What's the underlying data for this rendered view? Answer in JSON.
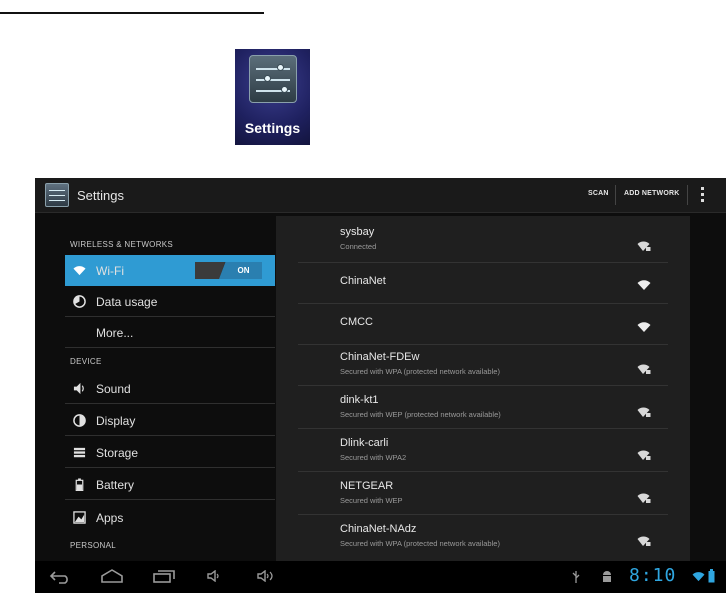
{
  "launcher_icon": {
    "label": "Settings",
    "icon": "settings-sliders-icon"
  },
  "action_bar": {
    "title": "Settings",
    "actions": [
      {
        "label": "SCAN"
      },
      {
        "label": "ADD NETWORK"
      }
    ],
    "overflow_icon": "overflow-menu-icon"
  },
  "sidebar": {
    "headers": {
      "wireless": "WIRELESS & NETWORKS",
      "device": "DEVICE",
      "personal": "PERSONAL"
    },
    "items": [
      {
        "label": "Wi-Fi",
        "icon": "wifi-icon",
        "selected": true,
        "toggle": "ON"
      },
      {
        "label": "Data usage",
        "icon": "data-usage-icon"
      },
      {
        "label": "More...",
        "icon": ""
      },
      {
        "label": "Sound",
        "icon": "sound-icon"
      },
      {
        "label": "Display",
        "icon": "display-icon"
      },
      {
        "label": "Storage",
        "icon": "storage-icon"
      },
      {
        "label": "Battery",
        "icon": "battery-icon"
      },
      {
        "label": "Apps",
        "icon": "apps-icon"
      }
    ]
  },
  "networks": [
    {
      "name": "sysbay",
      "status": "Connected",
      "secured": true
    },
    {
      "name": "ChinaNet",
      "status": "",
      "secured": false
    },
    {
      "name": "CMCC",
      "status": "",
      "secured": false
    },
    {
      "name": "ChinaNet-FDEw",
      "status": "Secured with WPA (protected network available)",
      "secured": true
    },
    {
      "name": "dink-kt1",
      "status": "Secured with WEP (protected network available)",
      "secured": true
    },
    {
      "name": "Dlink-carli",
      "status": "Secured with WPA2",
      "secured": true
    },
    {
      "name": "NETGEAR",
      "status": "Secured with WEP",
      "secured": true
    },
    {
      "name": "ChinaNet-NAdz",
      "status": "Secured with WPA (protected network available)",
      "secured": true
    }
  ],
  "status_bar": {
    "clock": "8:10",
    "nav_icons": [
      "back-icon",
      "home-icon",
      "recent-apps-icon",
      "volume-down-icon",
      "volume-up-icon"
    ],
    "status_icons": [
      "usb-icon",
      "android-debug-icon",
      "wifi-signal-icon",
      "battery-icon"
    ]
  },
  "colors": {
    "accent": "#2f9bd3",
    "clock": "#2fa6e0",
    "toggle_on": "#2a7fb0"
  }
}
